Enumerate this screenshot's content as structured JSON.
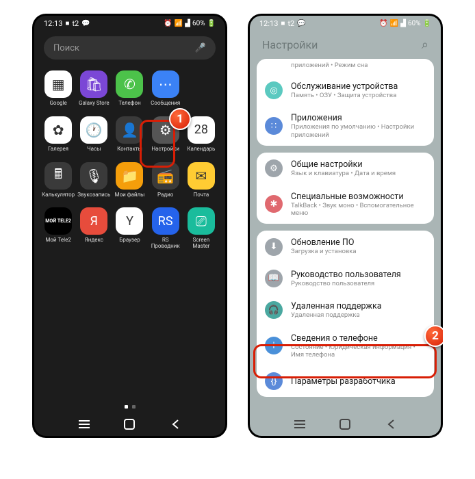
{
  "status": {
    "time": "12:13",
    "carrier": "t2",
    "battery": "60%"
  },
  "launcher": {
    "search_placeholder": "Поиск",
    "apps": [
      {
        "label": "Google",
        "icon": "grid",
        "bg": "bg-white"
      },
      {
        "label": "Galaxy Store",
        "icon": "bag",
        "bg": "bg-purple"
      },
      {
        "label": "Телефон",
        "icon": "phone",
        "bg": "bg-green"
      },
      {
        "label": "Сообщения",
        "icon": "msg",
        "bg": "bg-blue"
      },
      {
        "label": "",
        "icon": "",
        "bg": ""
      },
      {
        "label": "Галерея",
        "icon": "flower",
        "bg": "bg-white"
      },
      {
        "label": "Часы",
        "icon": "clock",
        "bg": "bg-white"
      },
      {
        "label": "Контакты",
        "icon": "person",
        "bg": "bg-dark"
      },
      {
        "label": "Настройки",
        "icon": "gear",
        "bg": "bg-grey"
      },
      {
        "label": "Календарь",
        "icon": "28",
        "bg": "bg-white",
        "text_icon": "28"
      },
      {
        "label": "Калькулятор",
        "icon": "calc",
        "bg": "bg-dark"
      },
      {
        "label": "Звукозапись",
        "icon": "mic",
        "bg": "bg-dark"
      },
      {
        "label": "Мои файлы",
        "icon": "folder",
        "bg": "bg-orange"
      },
      {
        "label": "Радио",
        "icon": "radio",
        "bg": "bg-dark"
      },
      {
        "label": "Почта",
        "icon": "mail",
        "bg": "bg-yellow"
      },
      {
        "label": "Мой Tele2",
        "icon": "tele2",
        "bg": "bg-black",
        "text_icon": "МОЙ TELE2"
      },
      {
        "label": "Яндекс",
        "icon": "Y",
        "bg": "bg-red",
        "text_icon": "Я"
      },
      {
        "label": "Браузер",
        "icon": "Y",
        "bg": "bg-white",
        "text_icon": "Y"
      },
      {
        "label": "RS Проводник",
        "icon": "RS",
        "bg": "bg-bluei",
        "text_icon": "RS"
      },
      {
        "label": "Screen Master",
        "icon": "screen",
        "bg": "bg-teal"
      }
    ]
  },
  "settings": {
    "header": "Настройки",
    "partial_top": "приложений • Режим сна",
    "groups": [
      [
        {
          "title": "Обслуживание устройства",
          "sub": "Память • ОЗУ • Защита устройства",
          "icon_class": "si-teal",
          "glyph": "◎"
        },
        {
          "title": "Приложения",
          "sub": "Приложения по умолчанию • Настройки приложений",
          "icon_class": "si-blue",
          "glyph": "∷"
        }
      ],
      [
        {
          "title": "Общие настройки",
          "sub": "Язык и клавиатура • Дата и время",
          "icon_class": "si-grey",
          "glyph": "⚙"
        },
        {
          "title": "Специальные возможности",
          "sub": "TalkBack • Звук моно • Вспомогательное меню",
          "icon_class": "si-red",
          "glyph": "✱"
        }
      ],
      [
        {
          "title": "Обновление ПО",
          "sub": "Загрузка и установка",
          "icon_class": "si-grey",
          "glyph": "⬇"
        },
        {
          "title": "Руководство пользователя",
          "sub": "Руководство пользователя",
          "icon_class": "si-grey",
          "glyph": "📖"
        },
        {
          "title": "Удаленная поддержка",
          "sub": "Удаленная поддержка",
          "icon_class": "si-turq",
          "glyph": "🎧"
        },
        {
          "title": "Сведения о телефоне",
          "sub": "Состояние • Юридическая информация • Имя телефона",
          "icon_class": "si-info",
          "glyph": "i"
        },
        {
          "title": "Параметры разработчика",
          "sub": "",
          "icon_class": "si-dev",
          "glyph": "{}"
        }
      ]
    ]
  },
  "annotations": {
    "badge1": "1",
    "badge2": "2"
  }
}
